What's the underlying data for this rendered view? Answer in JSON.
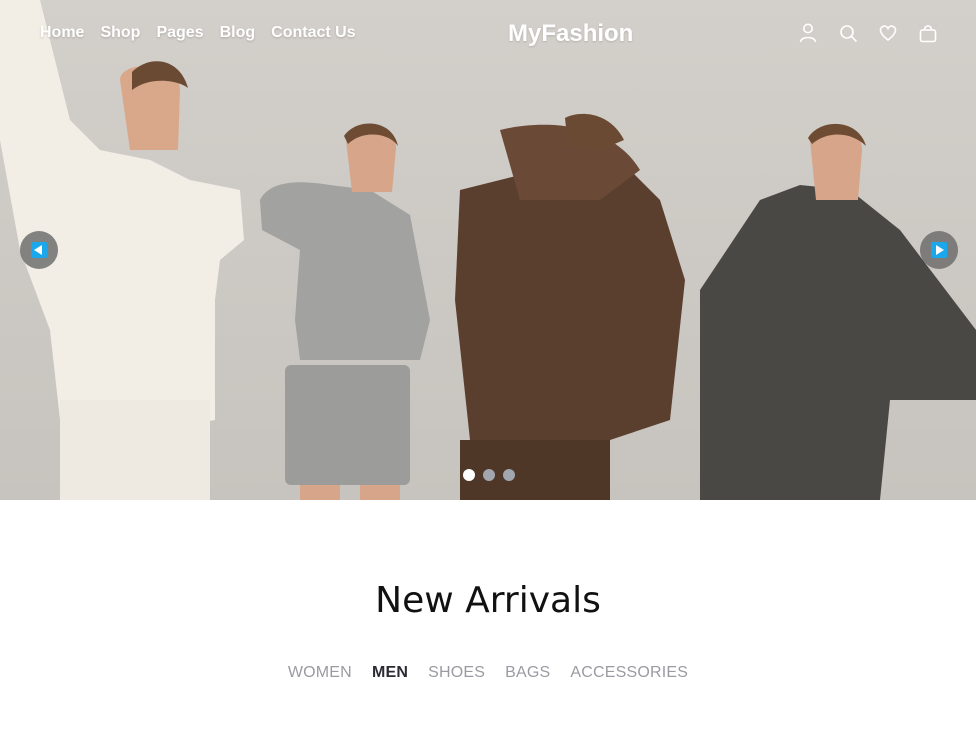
{
  "nav": {
    "links": [
      "Home",
      "Shop",
      "Pages",
      "Blog",
      "Contact Us"
    ],
    "brand": "MyFashion",
    "icons": [
      "user-icon",
      "search-icon",
      "heart-icon",
      "bag-icon"
    ]
  },
  "hero": {
    "slides_total": 3,
    "active_slide": 1,
    "arrow_color": "#1aa7ec"
  },
  "section": {
    "title": "New Arrivals",
    "filters": [
      "WOMEN",
      "MEN",
      "SHOES",
      "BAGS",
      "ACCESSORIES"
    ],
    "active_filter": "MEN"
  }
}
